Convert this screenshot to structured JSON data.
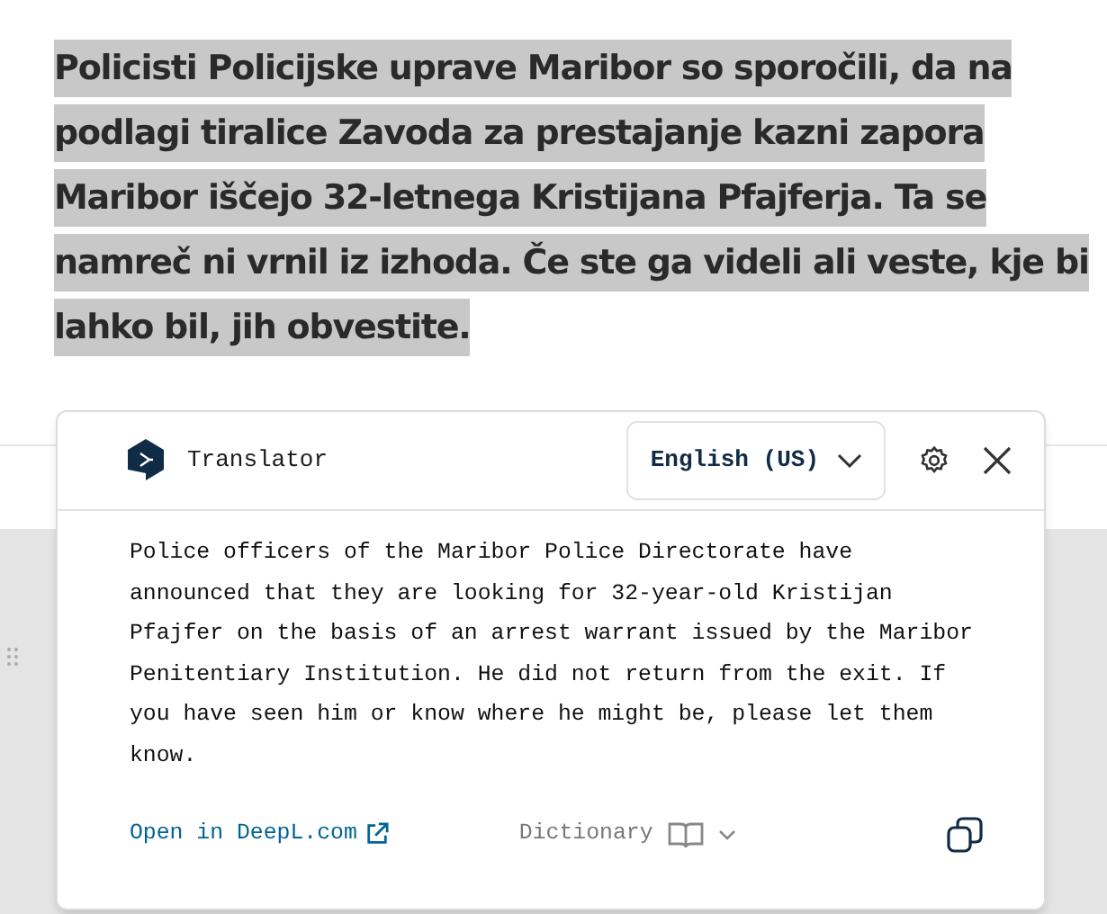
{
  "article": {
    "text": "Policisti Policijske uprave Maribor so sporočili, da na podlagi tiralice Zavoda za prestajanje kazni zapora Maribor iščejo 32-letnega Kristijana Pfajferja. Ta se namreč ni vrnil iz izhoda. Če ste ga videli ali veste, kje bi lahko bil, jih obvestite.",
    "selected": true
  },
  "translator": {
    "title": "Translator",
    "language": "English (US)",
    "translation": "Police officers of the Maribor Police Directorate have announced that they are looking for 32-year-old Kristijan Pfajfer on the basis of an arrest warrant issued by the Maribor Penitentiary Institution. He did not return from the exit. If you have seen him or know where he might be, please let them know.",
    "open_link": "Open in DeepL.com",
    "dictionary": "Dictionary"
  }
}
